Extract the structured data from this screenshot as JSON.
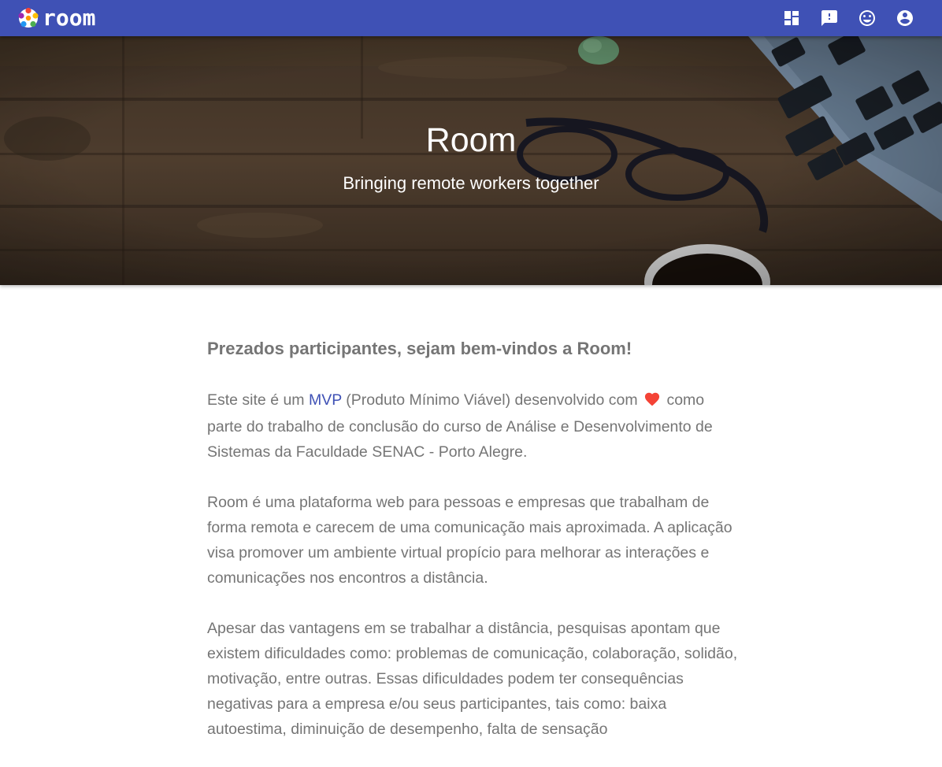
{
  "app": {
    "logo_text": "room"
  },
  "navbar": {
    "icons": [
      "dashboard-icon",
      "feedback-icon",
      "mood-icon",
      "account-circle-icon"
    ],
    "color": "#3f51b5"
  },
  "hero": {
    "title": "Room",
    "subtitle": "Bringing remote workers together"
  },
  "content": {
    "heading": "Prezados participantes, sejam bem-vindos a Room!",
    "paragraph1": {
      "before_link": "Este site é um ",
      "link_text": "MVP",
      "after_link": " (Produto Mínimo Viável) desenvolvido com ",
      "after_heart": " como parte do trabalho de conclusão do curso de Análise e Desenvolvimento de Sistemas da Faculdade SENAC - Porto Alegre."
    },
    "paragraph2": "Room é uma plataforma web para pessoas e empresas que trabalham de forma remota e carecem de uma comunicação mais aproximada. A aplicação visa promover um ambiente virtual propício para melhorar as interações e comunicações nos encontros a distância.",
    "paragraph3": "Apesar das vantagens em se trabalhar a distância, pesquisas apontam que existem dificuldades como: problemas de comunicação, colaboração, solidão, motivação, entre outras. Essas dificuldades podem ter consequências negativas para a empresa e/ou seus participantes, tais como: baixa autoestima, diminuição de desempenho, falta de sensação"
  },
  "colors": {
    "primary": "#3f51b5",
    "text": "#757575",
    "heart": "#f44336"
  }
}
